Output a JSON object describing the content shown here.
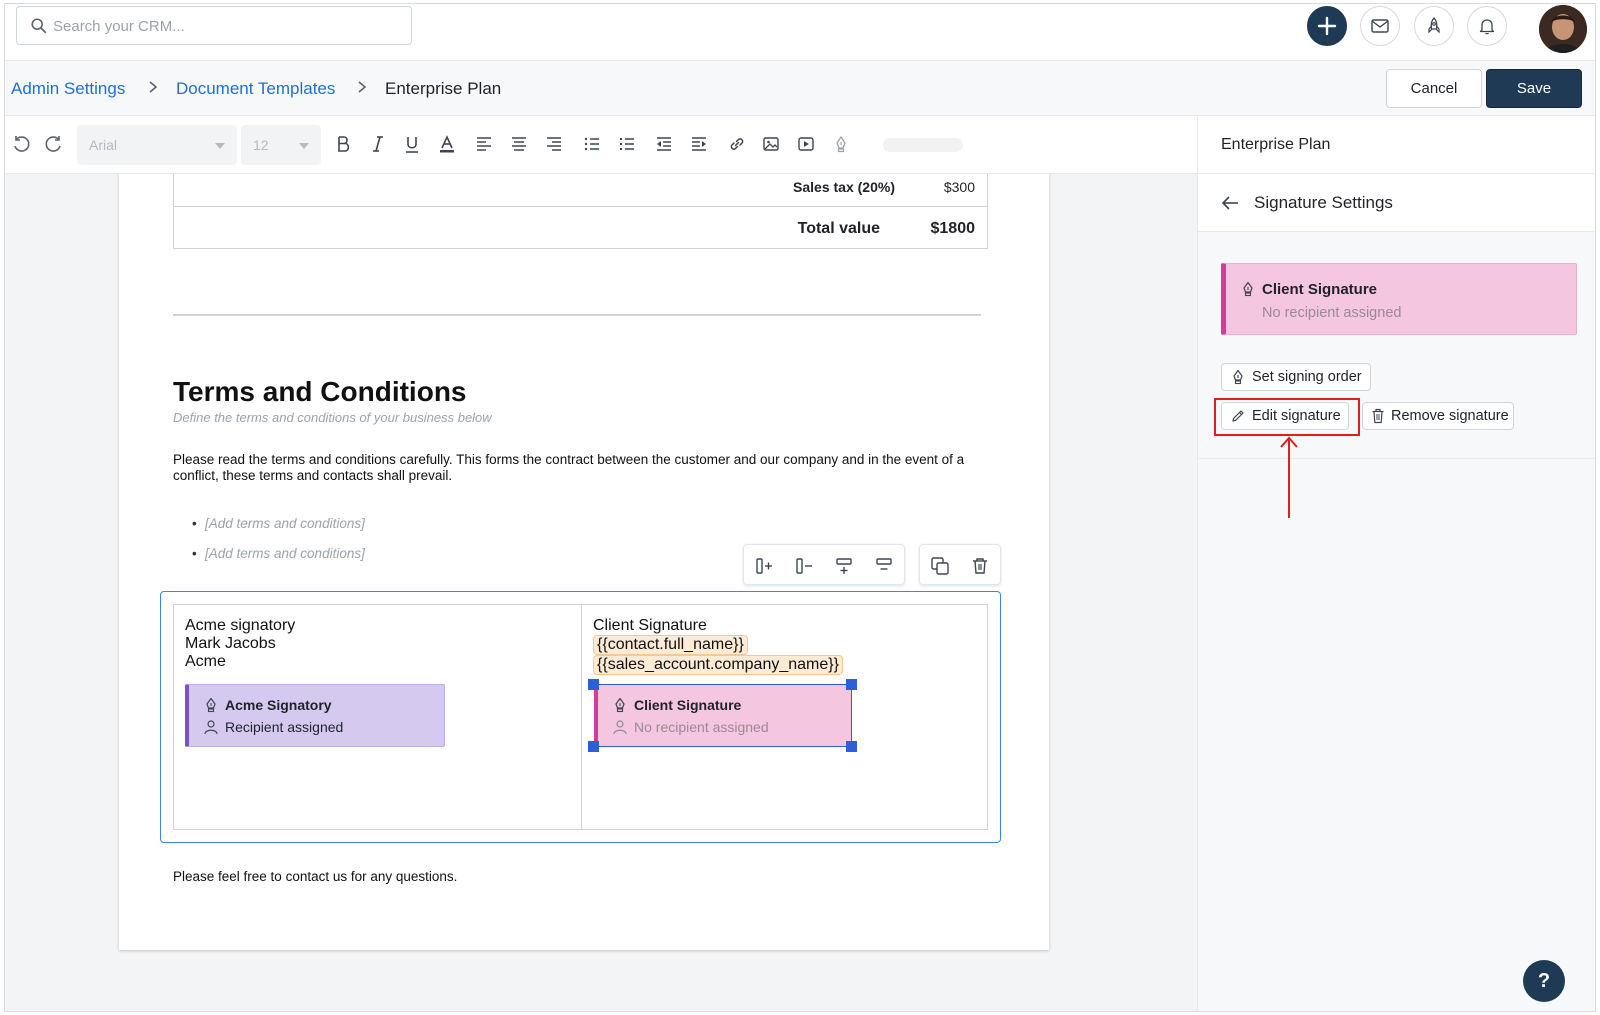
{
  "search": {
    "placeholder": "Search your CRM..."
  },
  "breadcrumb": {
    "items": [
      "Admin Settings",
      "Document Templates"
    ],
    "current": "Enterprise Plan"
  },
  "actions": {
    "cancel": "Cancel",
    "save": "Save"
  },
  "toolbar": {
    "font": "Arial",
    "size": "12"
  },
  "document": {
    "totals": [
      {
        "label": "Sales tax (20%)",
        "value": "$300"
      },
      {
        "label": "Total value",
        "value": "$1800"
      }
    ],
    "terms_title": "Terms and Conditions",
    "terms_subtitle": "Define the terms and conditions of your business below",
    "terms_body": "Please read the terms and conditions carefully. This forms the contract between the customer and our company and in the event of a conflict, these terms and contacts shall prevail.",
    "bullets": [
      "[Add terms and conditions]",
      "[Add terms and conditions]"
    ],
    "left_cell": {
      "line1": "Acme signatory",
      "line2": "Mark Jacobs",
      "line3": "Acme"
    },
    "right_cell": {
      "line1": "Client Signature",
      "token1": "{{contact.full_name}}",
      "token2": "{{sales_account.company_name}}"
    },
    "acme_sig": {
      "title": "Acme Signatory",
      "status": "Recipient assigned",
      "color": "#7b52c9"
    },
    "client_sig": {
      "title": "Client Signature",
      "status": "No recipient assigned",
      "color": "#d63b95"
    },
    "closing": "Please feel free to contact us for any questions."
  },
  "panel": {
    "title": "Enterprise Plan",
    "subtitle": "Signature Settings",
    "card_title": "Client Signature",
    "card_status": "No recipient assigned",
    "set_order": "Set signing order",
    "edit": "Edit signature",
    "remove": "Remove signature"
  },
  "help": "?"
}
